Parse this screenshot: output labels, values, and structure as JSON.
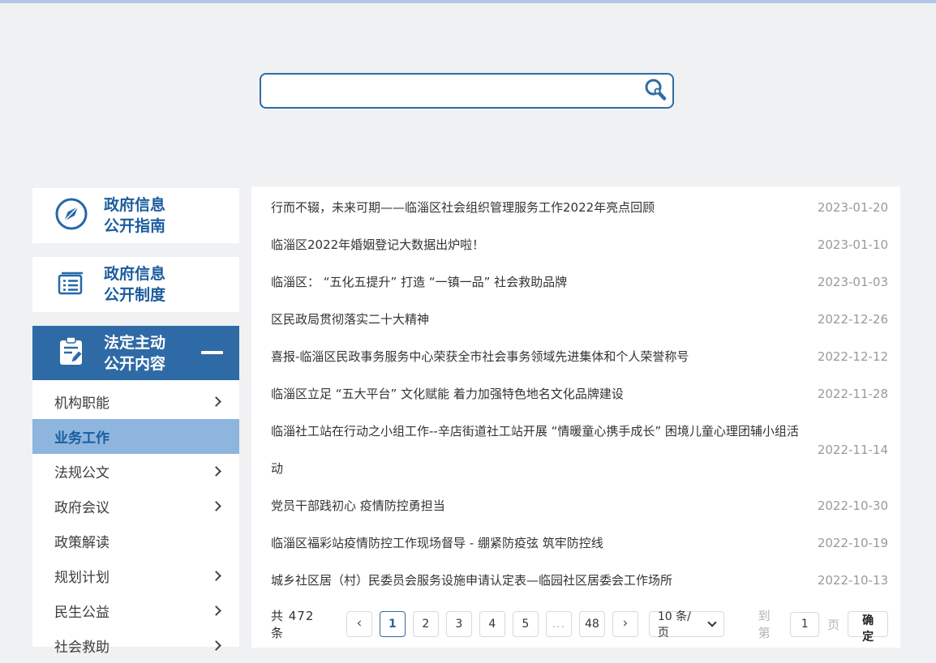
{
  "colors": {
    "accent_blue": "#2e6aa5",
    "link_blue": "#1c5c9e",
    "top_strip": "#b3c6e7",
    "submenu_highlight": "#8db5de",
    "page_background": "#f0f1f2",
    "date_gray": "#9a9a9a"
  },
  "search": {
    "value": ""
  },
  "sidebar": {
    "sections": [
      {
        "line1": "政府信息",
        "line2": "公开指南",
        "icon": "compass-icon",
        "selected": false
      },
      {
        "line1": "政府信息",
        "line2": "公开制度",
        "icon": "ledger-icon",
        "selected": false
      },
      {
        "line1": "法定主动",
        "line2": "公开内容",
        "icon": "clipboard-pen-icon",
        "selected": true
      }
    ],
    "submenu": [
      {
        "label": "机构职能",
        "has_arrow": true,
        "active": false
      },
      {
        "label": "业务工作",
        "has_arrow": false,
        "active": true
      },
      {
        "label": "法规公文",
        "has_arrow": true,
        "active": false
      },
      {
        "label": "政府会议",
        "has_arrow": true,
        "active": false
      },
      {
        "label": "政策解读",
        "has_arrow": false,
        "active": false
      },
      {
        "label": "规划计划",
        "has_arrow": true,
        "active": false
      },
      {
        "label": "民生公益",
        "has_arrow": true,
        "active": false
      },
      {
        "label": "社会救助",
        "has_arrow": true,
        "active": false
      }
    ]
  },
  "articles": [
    {
      "title": "行而不辍，未来可期——临淄区社会组织管理服务工作2022年亮点回顾",
      "date": "2023-01-20"
    },
    {
      "title": "临淄区2022年婚姻登记大数据出炉啦！",
      "date": "2023-01-10"
    },
    {
      "title": "临淄区： “五化五提升” 打造 “一镇一品” 社会救助品牌",
      "date": "2023-01-03"
    },
    {
      "title": "区民政局贯彻落实二十大精神",
      "date": "2022-12-26"
    },
    {
      "title": "喜报-临淄区民政事务服务中心荣获全市社会事务领域先进集体和个人荣誉称号",
      "date": "2022-12-12"
    },
    {
      "title": "临淄区立足 “五大平台” 文化赋能 着力加强特色地名文化品牌建设",
      "date": "2022-11-28"
    },
    {
      "title": "临淄社工站在行动之小组工作--辛店街道社工站开展 “情暖童心携手成长” 困境儿童心理团辅小组活动",
      "date": "2022-11-14"
    },
    {
      "title": "党员干部践初心 疫情防控勇担当",
      "date": "2022-10-30"
    },
    {
      "title": "临淄区福彩站疫情防控工作现场督导 - 绷紧防疫弦 筑牢防控线",
      "date": "2022-10-19"
    },
    {
      "title": "城乡社区居（村）民委员会服务设施申请认定表—临园社区居委会工作场所",
      "date": "2022-10-13"
    }
  ],
  "pagination": {
    "total_label": "共 472 条",
    "prev_label": "‹",
    "next_label": "›",
    "pages": [
      "1",
      "2",
      "3",
      "4",
      "5",
      "...",
      "48"
    ],
    "active_page": "1",
    "page_size_label": "10 条/页",
    "goto_prefix": "到第",
    "goto_value": "1",
    "goto_suffix": "页",
    "confirm_label": "确定"
  }
}
